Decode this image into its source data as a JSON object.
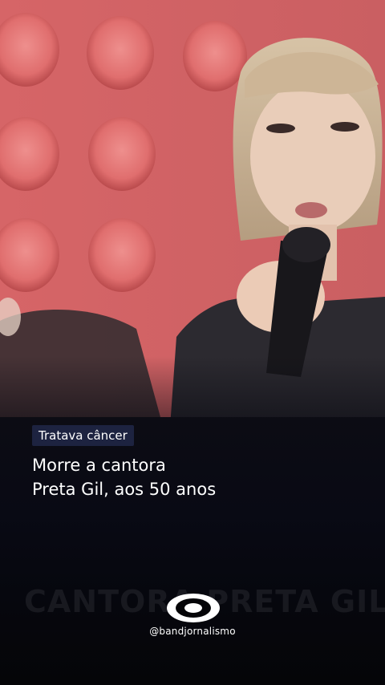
{
  "video": {
    "category_tag": "Tratava câncer",
    "headline_line1": "Morre a cantora",
    "headline_line2": "Preta Gil, aos 50 anos",
    "background_caption": "CANTORA PRETA GIL"
  },
  "brand": {
    "logo": "band-logo-icon",
    "handle": "@bandjornalismo",
    "accent": "#1d2340"
  }
}
